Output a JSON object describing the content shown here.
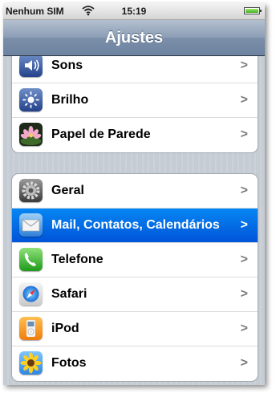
{
  "status_bar": {
    "carrier": "Nenhum SIM",
    "wifi_icon": "wifi-icon",
    "time": "15:19",
    "battery_icon": "battery-full-icon"
  },
  "navbar": {
    "title": "Ajustes"
  },
  "groups": [
    {
      "rows": [
        {
          "label": "Sons",
          "icon": "speaker-icon"
        },
        {
          "label": "Brilho",
          "icon": "sun-icon"
        },
        {
          "label": "Papel de Parede",
          "icon": "wallpaper-flower-icon"
        }
      ]
    },
    {
      "rows": [
        {
          "label": "Geral",
          "icon": "gear-icon"
        },
        {
          "label": "Mail, Contatos, Calendários",
          "icon": "mail-icon",
          "selected": true
        },
        {
          "label": "Telefone",
          "icon": "phone-icon"
        },
        {
          "label": "Safari",
          "icon": "safari-compass-icon"
        },
        {
          "label": "iPod",
          "icon": "ipod-icon"
        },
        {
          "label": "Fotos",
          "icon": "sunflower-icon"
        }
      ]
    }
  ],
  "colors": {
    "selected_row": "#0168e0",
    "navbar": "#7b8ea9",
    "background": "#c5ccd4"
  },
  "chevron_glyph": ">"
}
